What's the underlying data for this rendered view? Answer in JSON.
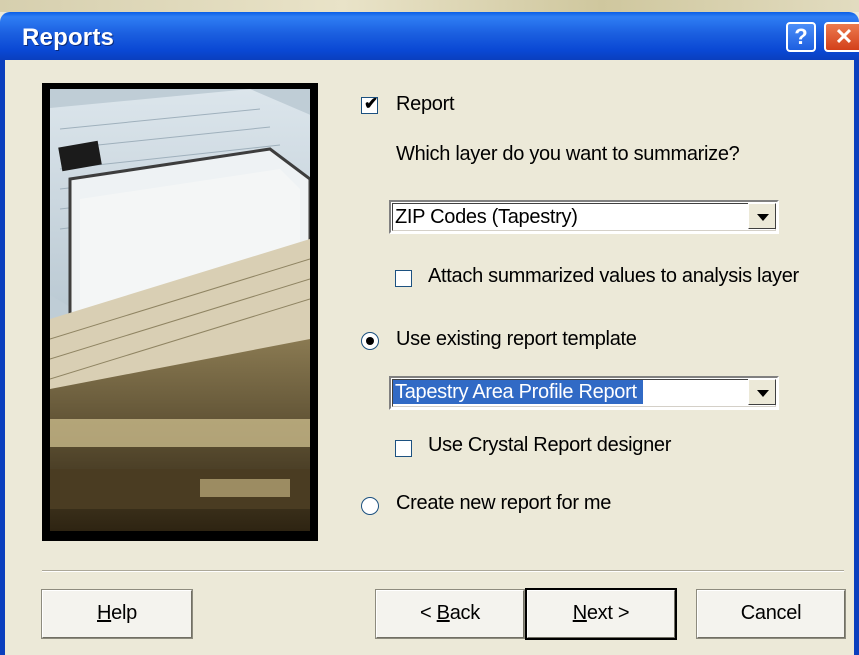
{
  "window": {
    "title": "Reports",
    "help_glyph": "?",
    "close_glyph": "✕"
  },
  "report_checkbox": {
    "label": "Report",
    "checked": true
  },
  "layer_question": "Which layer do you want to summarize?",
  "layer_combo": {
    "value": "ZIP Codes (Tapestry)"
  },
  "attach_checkbox": {
    "label": "Attach summarized values to analysis layer",
    "checked": false
  },
  "existing_template_radio": {
    "label": "Use existing report template",
    "selected": true
  },
  "template_combo": {
    "value": "Tapestry Area Profile Report"
  },
  "crystal_checkbox": {
    "label": "Use Crystal Report designer",
    "checked": false
  },
  "new_report_radio": {
    "label": "Create new report for me",
    "selected": false
  },
  "buttons": {
    "help": {
      "accel": "H",
      "rest": "elp"
    },
    "back": {
      "prefix": "< ",
      "accel": "B",
      "rest": "ack"
    },
    "next": {
      "accel": "N",
      "rest": "ext >"
    },
    "cancel": "Cancel"
  },
  "icons": [
    "help-icon",
    "close-icon",
    "dropdown-arrow-icon",
    "checkmark-icon"
  ],
  "colors": {
    "titlebar": "#0a48d4",
    "selection": "#316ac5",
    "dialog_bg": "#ece9d8"
  }
}
